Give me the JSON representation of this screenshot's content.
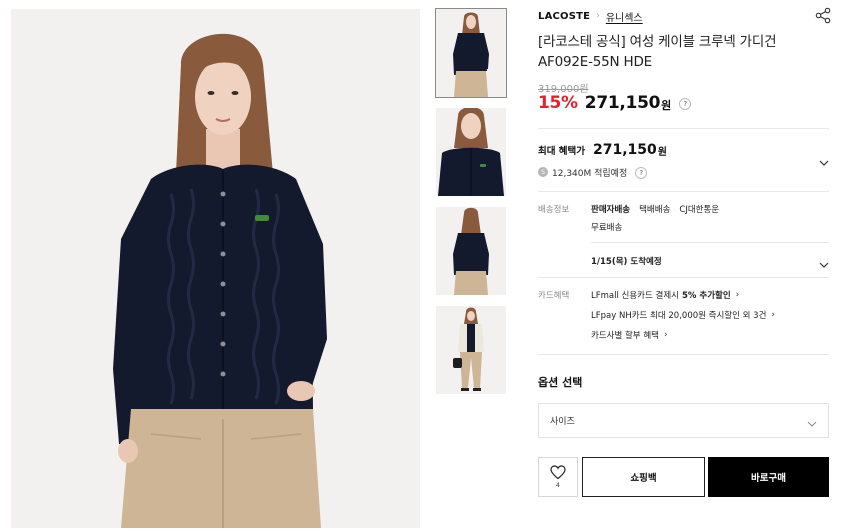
{
  "gallery": {
    "main_image_alt": "",
    "thumbnails": [
      {
        "id": "thumb-1",
        "active": true
      },
      {
        "id": "thumb-2",
        "active": false
      },
      {
        "id": "thumb-3",
        "active": false
      },
      {
        "id": "thumb-4",
        "active": false
      }
    ]
  },
  "product": {
    "brand": "LACOSTE",
    "category": "유니섹스",
    "title": "[라코스테 공식] 여성 케이블 크루넥 가디건 AF092E-55N HDE",
    "original_price": "319,000원",
    "discount": "15%",
    "sale_price": "271,150",
    "currency": "원",
    "help_icon_text": "?"
  },
  "benefit": {
    "label": "최대 혜택가",
    "price": "271,150",
    "currency": "원",
    "points": "12,340M 적립예정",
    "points_icon_text": "S"
  },
  "shipping": {
    "label": "배송정보",
    "options": [
      "판매자배송",
      "택배배송",
      "CJ대한통운"
    ],
    "fee": "무료배송",
    "arrival": "1/15(목) 도착예정"
  },
  "card": {
    "label": "카드혜택",
    "line1_prefix": "LFmall 신용카드 결제시",
    "line1_bold": "5% 추가할인",
    "line2": "LFpay NH카드 최대 20,000원 즉시할인 외 3건",
    "line3": "카드사별 할부 혜택",
    "arrow": "›"
  },
  "options": {
    "title": "옵션 선택",
    "size_placeholder": "사이즈"
  },
  "actions": {
    "wish_count": "4",
    "cart_label": "쇼핑백",
    "buy_label": "바로구매"
  },
  "colors": {
    "discount": "#e3222b",
    "buy_button": "#000000",
    "sweater": "#141a2e",
    "pants": "#cdb595"
  },
  "icons": {
    "share": "share-icon",
    "heart": "heart-icon",
    "chevron": "chevron-down-icon"
  }
}
